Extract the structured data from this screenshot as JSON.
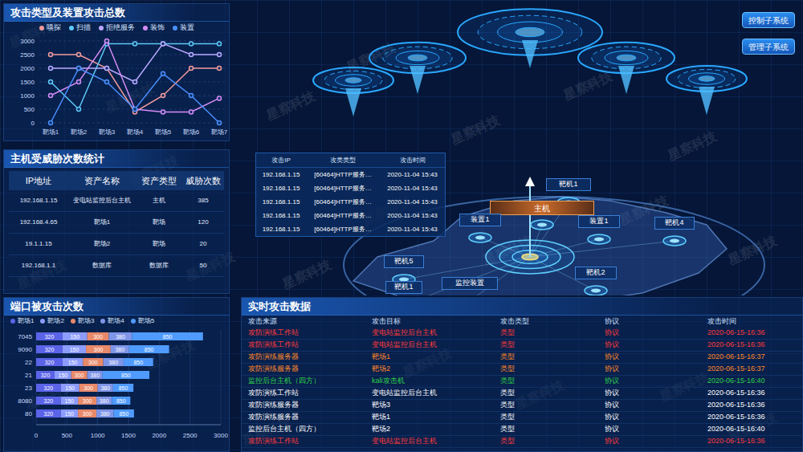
{
  "watermark": "星察科技",
  "attack_chart": {
    "title": "攻击类型及装置攻击总数",
    "y_ticks": [
      "3000",
      "2500",
      "2000",
      "1500",
      "1000",
      "500",
      "0"
    ],
    "x_labels": [
      "靶场1",
      "靶场2",
      "靶场3",
      "靶场4",
      "靶场5",
      "靶场6",
      "靶场7"
    ],
    "series": [
      {
        "name": "嗅探",
        "color": "#f29b9b",
        "values": [
          2500,
          2500,
          2000,
          400,
          1000,
          2000,
          2000
        ]
      },
      {
        "name": "扫描",
        "color": "#5ec8f8",
        "values": [
          1500,
          500,
          2900,
          2900,
          2900,
          2900,
          2900
        ]
      },
      {
        "name": "拒绝服务",
        "color": "#b8a8ff",
        "values": [
          2000,
          2000,
          2000,
          1500,
          2900,
          2500,
          2500
        ]
      },
      {
        "name": "装饰",
        "color": "#d48cf5",
        "values": [
          1000,
          1500,
          3000,
          500,
          400,
          400,
          900
        ]
      },
      {
        "name": "装置",
        "color": "#4a90ff",
        "values": [
          0,
          2000,
          1500,
          500,
          1800,
          1000,
          0
        ]
      }
    ]
  },
  "threat_table": {
    "title": "主机受威胁次数统计",
    "columns": [
      "IP地址",
      "资产名称",
      "资产类型",
      "威胁次数"
    ],
    "rows": [
      [
        "192.168.1.15",
        "变电站监控后台主机",
        "主机",
        "385"
      ],
      [
        "192.168.4.65",
        "靶场1",
        "靶场",
        "120"
      ],
      [
        "19.1.1.15",
        "靶场2",
        "靶场",
        "20"
      ],
      [
        "192.168.1.1",
        "数据库",
        "数据库",
        "50"
      ]
    ]
  },
  "port_chart": {
    "title": "端口被攻击次数",
    "legend": [
      {
        "name": "靶场1",
        "color": "#5b63e8"
      },
      {
        "name": "靶场2",
        "color": "#8c9cff"
      },
      {
        "name": "靶场3",
        "color": "#e8896a"
      },
      {
        "name": "靶场4",
        "color": "#7f95e8"
      },
      {
        "name": "靶场5",
        "color": "#4f9bff"
      }
    ],
    "x_ticks": [
      "0",
      "500",
      "1000",
      "1500",
      "2000",
      "2500",
      "3000"
    ],
    "rows": [
      {
        "port": "7045",
        "segments": [
          {
            "value": 430,
            "label": "320"
          },
          {
            "value": 400,
            "label": "150"
          },
          {
            "value": 350,
            "label": "300"
          },
          {
            "value": 380,
            "label": "380"
          },
          {
            "value": 1150,
            "label": "850"
          }
        ]
      },
      {
        "port": "9090",
        "segments": [
          {
            "value": 430,
            "label": "320"
          },
          {
            "value": 380,
            "label": "150"
          },
          {
            "value": 400,
            "label": "300"
          },
          {
            "value": 300,
            "label": "380"
          },
          {
            "value": 650,
            "label": "850"
          }
        ]
      },
      {
        "port": "22",
        "segments": [
          {
            "value": 430,
            "label": "320"
          },
          {
            "value": 330,
            "label": "150"
          },
          {
            "value": 330,
            "label": "300"
          },
          {
            "value": 330,
            "label": "380"
          },
          {
            "value": 480,
            "label": "850"
          }
        ]
      },
      {
        "port": "21",
        "segments": [
          {
            "value": 300,
            "label": "320"
          },
          {
            "value": 270,
            "label": "150"
          },
          {
            "value": 260,
            "label": "300"
          },
          {
            "value": 250,
            "label": "380"
          },
          {
            "value": 760,
            "label": "850"
          }
        ]
      },
      {
        "port": "23",
        "segments": [
          {
            "value": 400,
            "label": "320"
          },
          {
            "value": 300,
            "label": "150"
          },
          {
            "value": 300,
            "label": "300"
          },
          {
            "value": 250,
            "label": "380"
          },
          {
            "value": 330,
            "label": "850"
          }
        ]
      },
      {
        "port": "8080",
        "segments": [
          {
            "value": 400,
            "label": "320"
          },
          {
            "value": 280,
            "label": "150"
          },
          {
            "value": 300,
            "label": "300"
          },
          {
            "value": 250,
            "label": "380"
          },
          {
            "value": 300,
            "label": "850"
          }
        ]
      },
      {
        "port": "80",
        "segments": [
          {
            "value": 400,
            "label": "320"
          },
          {
            "value": 280,
            "label": "150"
          },
          {
            "value": 300,
            "label": "300"
          },
          {
            "value": 280,
            "label": "380"
          },
          {
            "value": 330,
            "label": "850"
          }
        ]
      }
    ]
  },
  "buttons": [
    {
      "label": "控制子系统"
    },
    {
      "label": "管理子系统"
    }
  ],
  "attack_list": {
    "columns": [
      "攻击IP",
      "攻类类型",
      "攻击时间"
    ],
    "rows": [
      [
        "192.168.1.15",
        "[60464]HTTP服务…",
        "2020-11-04 15:43"
      ],
      [
        "192.168.1.15",
        "[60464]HTTP服务…",
        "2020-11-04 15:43"
      ],
      [
        "192.168.1.15",
        "[60464]HTTP服务…",
        "2020-11-04 15:43"
      ],
      [
        "192.168.1.15",
        "[60464]HTTP服务…",
        "2020-11-04 15:43"
      ],
      [
        "192.168.1.15",
        "[60464]HTTP服务…",
        "2020-11-04 15:43"
      ]
    ]
  },
  "map": {
    "nodes": [
      {
        "label": "靶机1",
        "kind": "target"
      },
      {
        "label": "主机",
        "kind": "host"
      },
      {
        "label": "装置1",
        "kind": "target"
      },
      {
        "label": "装置1",
        "kind": "target"
      },
      {
        "label": "靶机4",
        "kind": "target"
      },
      {
        "label": "靶机5",
        "kind": "target"
      },
      {
        "label": "监控装置",
        "kind": "target"
      },
      {
        "label": "靶机2",
        "kind": "target"
      },
      {
        "label": "靶机1",
        "kind": "target"
      }
    ]
  },
  "realtime": {
    "title": "实时攻击数据",
    "columns": [
      "攻击来源",
      "攻击目标",
      "攻击类型",
      "协议",
      "攻击时间"
    ],
    "rows": [
      {
        "cells": [
          "攻防演练工作站",
          "变电站监控后台主机",
          "类型",
          "协议",
          "2020-06-15-16:36"
        ],
        "color": "#ff3b3b"
      },
      {
        "cells": [
          "攻防演练工作站",
          "变电站监控后台主机",
          "类型",
          "协议",
          "2020-06-15-16:36"
        ],
        "color": "#ff3b3b"
      },
      {
        "cells": [
          "攻防演练服务器",
          "靶场1",
          "类型",
          "协议",
          "2020-06-15-16:37"
        ],
        "color": "#ff8a2a"
      },
      {
        "cells": [
          "攻防演练服务器",
          "靶场2",
          "类型",
          "协议",
          "2020-06-15-16:37"
        ],
        "color": "#ff8a2a"
      },
      {
        "cells": [
          "监控后台主机（四方）",
          "kali攻击机",
          "类型",
          "协议",
          "2020-06-15-16:40"
        ],
        "color": "#2fd04a"
      },
      {
        "cells": [
          "攻防演练工作站",
          "变电站监控后台主机",
          "类型",
          "协议",
          "2020-06-15-16:36"
        ],
        "color": "#ffffff"
      },
      {
        "cells": [
          "攻防演练服务器",
          "靶场3",
          "类型",
          "协议",
          "2020-06-15-16:36"
        ],
        "color": "#ffffff"
      },
      {
        "cells": [
          "攻防演练服务器",
          "靶场1",
          "类型",
          "协议",
          "2020-06-15-16:36"
        ],
        "color": "#ffffff"
      },
      {
        "cells": [
          "监控后台主机（四方）",
          "靶场2",
          "类型",
          "协议",
          "2020-06-15-16:40"
        ],
        "color": "#ffffff"
      },
      {
        "cells": [
          "攻防演练工作站",
          "变电站监控后台主机",
          "类型",
          "协议",
          "2020-06-15-16:36"
        ],
        "color": "#ff3b3b"
      }
    ]
  }
}
